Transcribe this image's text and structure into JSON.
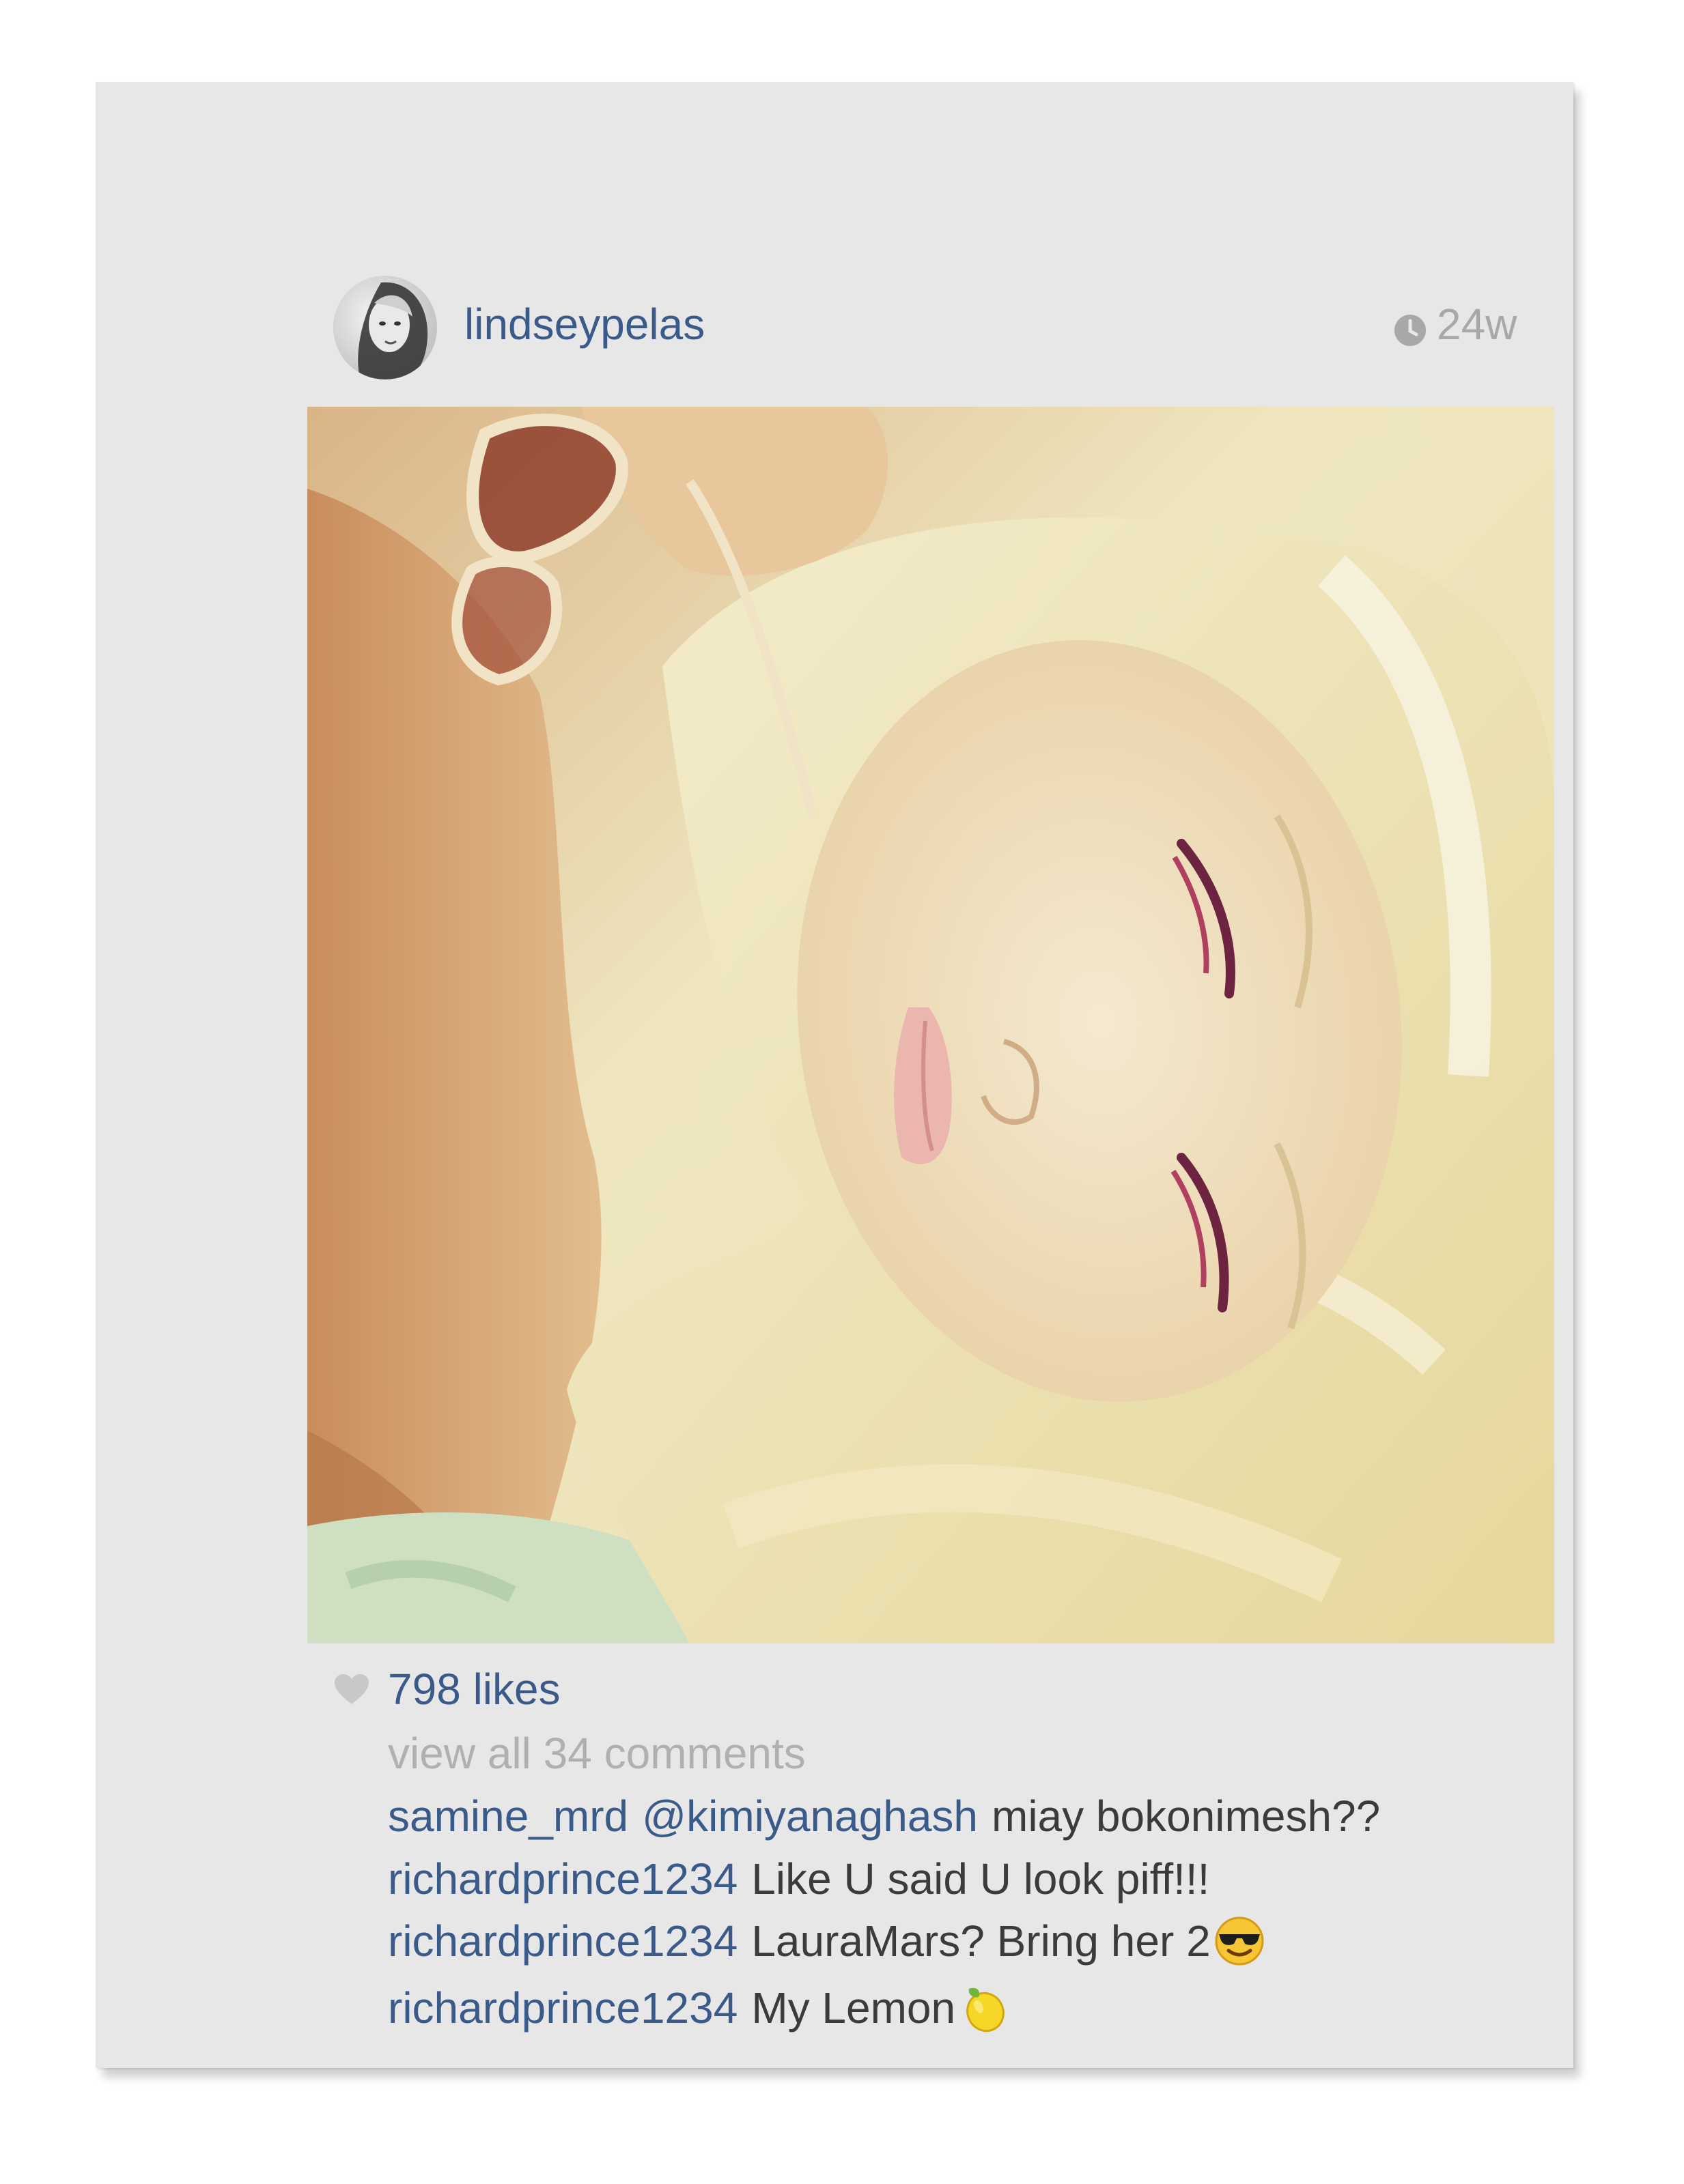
{
  "post": {
    "username": "lindseypelas",
    "time_ago": "24w",
    "likes": "798 likes",
    "view_all_comments": "view all 34 comments",
    "comments": [
      {
        "user": "samine_mrd",
        "mention": "@kimiyanaghash",
        "text": "miay bokonimesh??",
        "emoji": ""
      },
      {
        "user": "richardprince1234",
        "mention": "",
        "text": "Like U said U look piff!!!",
        "emoji": ""
      },
      {
        "user": "richardprince1234",
        "mention": "",
        "text": "LauraMars? Bring her 2",
        "emoji": "smiling-face-with-sunglasses"
      },
      {
        "user": "richardprince1234",
        "mention": "",
        "text": "My Lemon",
        "emoji": "lemon"
      }
    ]
  },
  "icons": {
    "clock": "clock-icon",
    "heart": "heart-icon"
  },
  "colors": {
    "username_blue": "#3a5a8a",
    "muted_gray": "#a8a8a8",
    "canvas_bg": "#e7e7e8"
  }
}
